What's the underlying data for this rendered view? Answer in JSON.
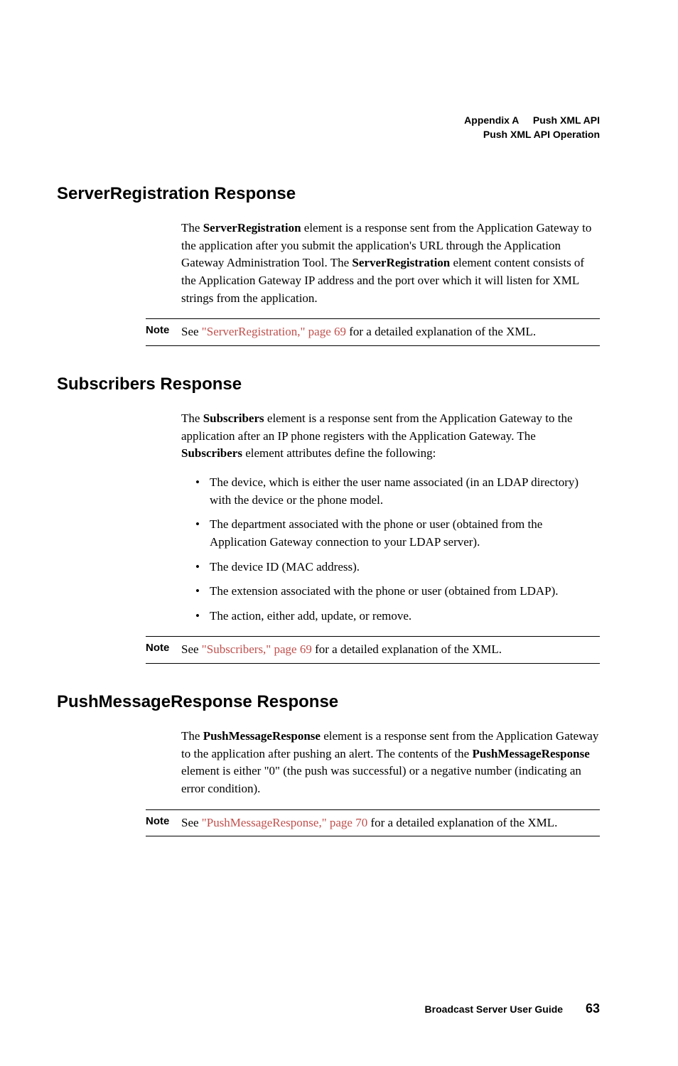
{
  "header": {
    "line1_prefix": "Appendix A",
    "line1_suffix": "Push XML API",
    "line2": "Push XML API Operation"
  },
  "sections": {
    "s1": {
      "heading": "ServerRegistration Response",
      "para": "The <b>ServerRegistration</b> element is a response sent from the Application Gateway to the application after you submit the application's URL through the Application Gateway Administration Tool. The <b>ServerRegistration</b> element content consists of the Application Gateway IP address and the port over which it will listen for XML strings from the application.",
      "note_label": "Note",
      "note_prefix": "See ",
      "note_link": "\"ServerRegistration,\" page 69",
      "note_suffix": " for a detailed explanation of the XML."
    },
    "s2": {
      "heading": "Subscribers Response",
      "para": "The <b>Subscribers</b> element is a response sent from the Application Gateway to the application after an IP phone registers with the Application Gateway. The <b>Subscribers</b> element attributes define the following:",
      "bullets": [
        "The device, which is either the user name associated (in an LDAP directory) with the device or the phone model.",
        "The department associated with the phone or user (obtained from the Application Gateway connection to your LDAP server).",
        "The device ID (MAC address).",
        "The extension associated with the phone or user (obtained from LDAP).",
        "The action, either add, update, or remove."
      ],
      "note_label": "Note",
      "note_prefix": "See ",
      "note_link": "\"Subscribers,\" page 69",
      "note_suffix": " for a detailed explanation of the XML."
    },
    "s3": {
      "heading": "PushMessageResponse Response",
      "para": "The <b>PushMessageResponse</b> element is a response sent from the Application Gateway to the application after pushing an alert. The contents of the <b>PushMessageResponse</b> element is either \"0\" (the push was successful) or a negative number (indicating an error condition).",
      "note_label": "Note",
      "note_prefix": "See ",
      "note_link": "\"PushMessageResponse,\" page 70",
      "note_suffix": " for a detailed explanation of the XML."
    }
  },
  "footer": {
    "text": "Broadcast Server User Guide",
    "pagenum": "63"
  }
}
